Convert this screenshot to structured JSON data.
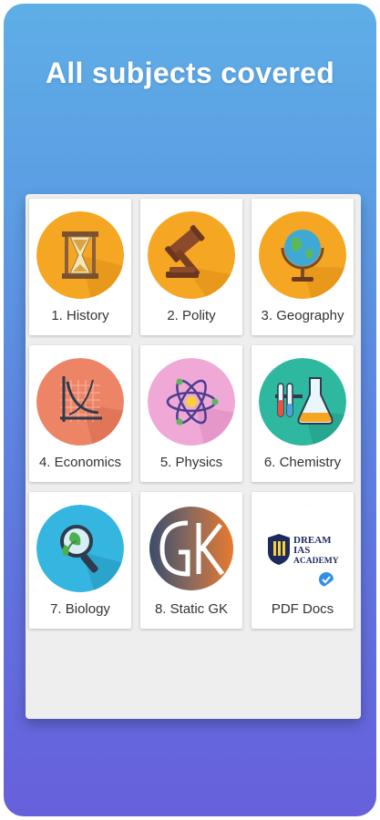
{
  "headline": "All subjects covered",
  "subjects": [
    {
      "label": "1. History",
      "icon": "hourglass-icon",
      "bg": "#f5a623"
    },
    {
      "label": "2. Polity",
      "icon": "gavel-icon",
      "bg": "#f5a623"
    },
    {
      "label": "3. Geography",
      "icon": "globe-icon",
      "bg": "#f5a623"
    },
    {
      "label": "4. Economics",
      "icon": "graph-icon",
      "bg": "#ee8466"
    },
    {
      "label": "5. Physics",
      "icon": "atom-icon",
      "bg": "#f0a8d6"
    },
    {
      "label": "6. Chemistry",
      "icon": "lab-flask-icon",
      "bg": "#2fb8a0"
    },
    {
      "label": "7. Biology",
      "icon": "magnifier-leaf-icon",
      "bg": "#34b6e0"
    },
    {
      "label": "8. Static GK",
      "icon": "gk-logo-icon",
      "bg": "#ffffff"
    },
    {
      "label": "PDF Docs",
      "icon": "dream-ias-academy-logo",
      "bg": "#ffffff",
      "logo_text": [
        "DREAM",
        "IAS",
        "ACADEMY"
      ]
    }
  ]
}
